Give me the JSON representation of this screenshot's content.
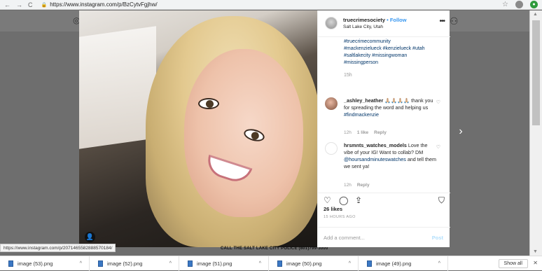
{
  "browser": {
    "url": "https://www.instagram.com/p/BzCytvFgjhw/",
    "nav_back": "←",
    "nav_forward": "→",
    "nav_reload": "C"
  },
  "post": {
    "username": "truecrimesociety",
    "follow_label": "• Follow",
    "location": "Salt Lake City, Utah",
    "more": "•••",
    "hashtags": [
      "#truecrimecommunity",
      "#mackenzielueck #kenzielueck #utah",
      "#saltlakecity #missingwoman",
      "#missingperson"
    ],
    "caption_time": "15h",
    "likes": "26 likes",
    "posted_ago": "15 HOURS AGO",
    "add_comment_placeholder": "Add a comment...",
    "post_label": "Post",
    "photo_caption": "CALL THE SALT LAKE CITY POLICE (801)799-3000"
  },
  "comments": [
    {
      "user": "_ashley_heather",
      "emoji": "🙏🏼🙏🏼🙏🏼🙏🏼",
      "text": "thank you for spreading the word and helping us",
      "tag": "#findmackenzie",
      "time": "12h",
      "likes": "1 like",
      "reply": "Reply"
    },
    {
      "user": "hrsmnts_watches_models",
      "text": "Love the vibe of your IG! Want to collab? DM",
      "tag": "@hoursandminuteswatches",
      "text2": "and tell them we sent ya!",
      "time": "12h",
      "reply": "Reply"
    }
  ],
  "status_url": "https://www.instagram.com/p/2071465582888570184/",
  "downloads": [
    {
      "name": "image (53).png"
    },
    {
      "name": "image (52).png"
    },
    {
      "name": "image (51).png"
    },
    {
      "name": "image (50).png"
    },
    {
      "name": "image (49).png"
    }
  ],
  "show_all_label": "Show all",
  "icons": {
    "heart": "♡",
    "comment": "◯",
    "share": "⇪",
    "bookmark": "⛉",
    "close": "✕",
    "chevron": "^",
    "next": "›"
  }
}
